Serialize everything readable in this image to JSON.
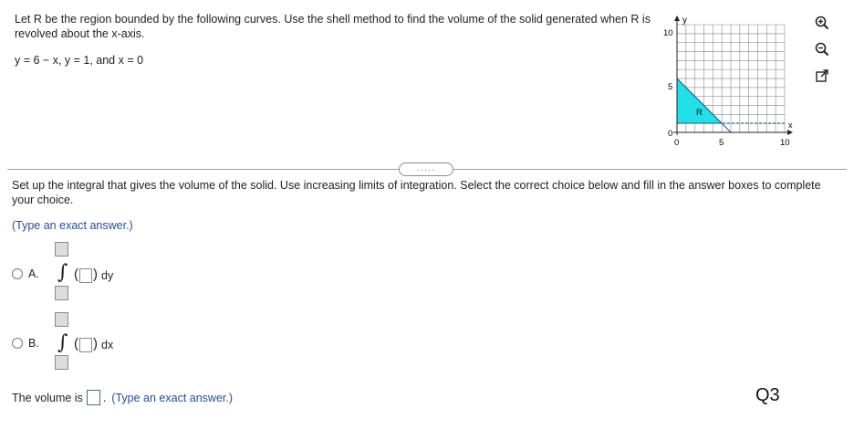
{
  "problem": {
    "statement": "Let R be the region bounded by the following curves. Use the shell method to find the volume of the solid generated when R is revolved about the x-axis.",
    "equations": "y = 6 − x, y = 1, and x = 0"
  },
  "graph": {
    "y_axis_label": "y",
    "x_axis_label": "x",
    "y_ticks": [
      "10",
      "5",
      "0"
    ],
    "x_ticks": [
      "0",
      "5",
      "10"
    ],
    "region_label": "R",
    "region_color": "#22e0e8",
    "grid_color": "#9a9a9a"
  },
  "tools": {
    "zoom_in": "zoom-in-icon",
    "zoom_out": "zoom-out-icon",
    "popout": "popout-icon"
  },
  "expand_button": "·····",
  "instructions": "Set up the integral that gives the volume of the solid. Use increasing limits of integration. Select the correct choice below and fill in the answer boxes to complete your choice.",
  "exact_hint": "(Type an exact answer.)",
  "choices": [
    {
      "letter": "A.",
      "integral_symbol": "∫",
      "differential": "dy"
    },
    {
      "letter": "B.",
      "integral_symbol": "∫",
      "differential": "dx"
    }
  ],
  "volume": {
    "label": "The volume is",
    "period": ".",
    "hint": "(Type an exact answer.)"
  },
  "question_tag": "Q3"
}
